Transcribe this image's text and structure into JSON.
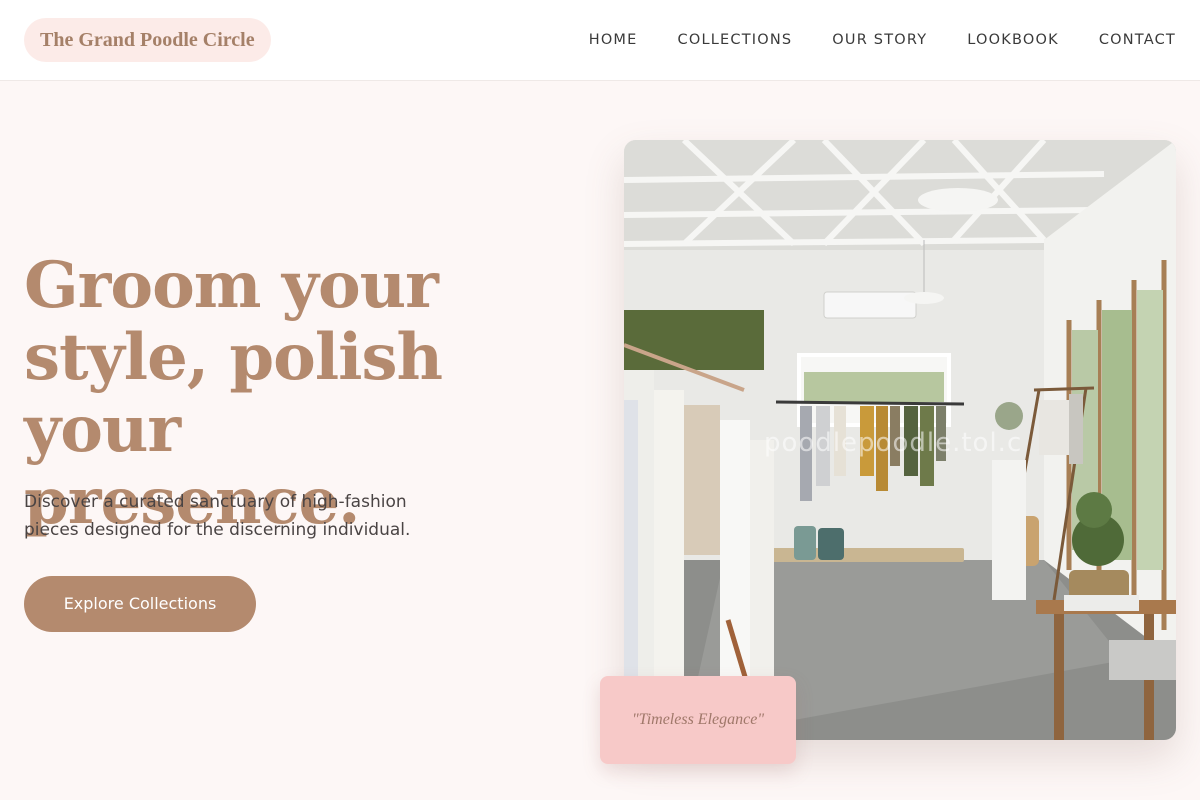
{
  "brand": {
    "name": "The Grand Poodle Circle"
  },
  "nav": {
    "items": [
      {
        "label": "HOME"
      },
      {
        "label": "COLLECTIONS"
      },
      {
        "label": "OUR STORY"
      },
      {
        "label": "LOOKBOOK"
      },
      {
        "label": "CONTACT"
      }
    ]
  },
  "hero": {
    "headline_line1": "Groom your",
    "headline_line2": "style, polish your",
    "headline_line3": "presence.",
    "subtitle_line1": "Discover a curated sanctuary of high-fashion",
    "subtitle_line2": "pieces designed for the discerning individual.",
    "cta_label": "Explore Collections"
  },
  "image": {
    "watermark": "poodlepoodle.tol.c",
    "badge_text": "\"Timeless Elegance\""
  },
  "colors": {
    "accent": "#b48a6e",
    "page_background": "#fdf7f6",
    "logo_background": "#fcebe8",
    "badge_background": "#f7c9c8"
  }
}
